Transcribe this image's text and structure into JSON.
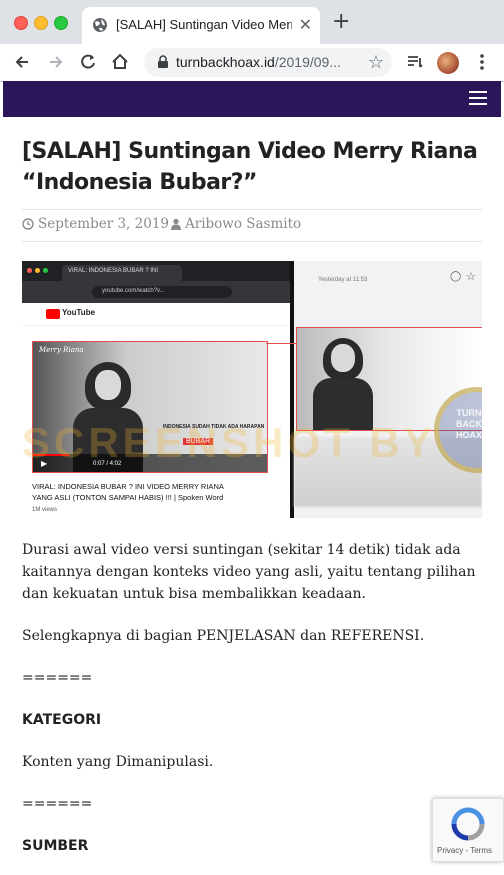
{
  "browser": {
    "tab_title": "[SALAH] Suntingan Video Merry Riana",
    "url_host": "turnbackhoax.id",
    "url_path": "/2019/09..."
  },
  "article": {
    "title": "[SALAH] Suntingan Video Merry Riana “Indonesia Bubar?”",
    "date": "September 3, 2019",
    "author": "Aribowo Sasmito",
    "paragraph1": "Durasi awal video versi suntingan (sekitar 14 detik) tidak ada kaitannya dengan konteks video yang asli, yaitu tentang pilihan dan kekuatan untuk bisa membalikkan keadaan.",
    "paragraph2": "Selengkapnya di bagian PENJELASAN dan REFERENSI.",
    "separator1": "======",
    "kategori_heading": "KATEGORI",
    "kategori_value": "Konten yang Dimanipulasi.",
    "separator2": "======",
    "sumber_heading": "SUMBER"
  },
  "featured_image": {
    "video_tab": "VIRAL: INDONESIA BUBAR ? INI",
    "video_url": "youtube.com/watch?v...",
    "youtube_logo": "YouTube",
    "watermark": "Merry Riana",
    "overlay_caption": "INDONESIA SUDAH TIDAK ADA HARAPAN",
    "overlay_caption2": "BUBAR",
    "time": "0:07 / 4:02",
    "video_title_line1": "VIRAL: INDONESIA BUBAR ? INI VIDEO MERRY RIANA",
    "video_title_line2": "YANG ASLI (TONTON SAMPAI HABIS) !!! | Spoken Word",
    "video_meta": "1M views",
    "fb_time": "Yesterday at 11:53",
    "screenshot_text": "SCREENSHOT BY",
    "stamp_text1": "TURN",
    "stamp_text2": "BACK",
    "stamp_text3": "HOAX"
  },
  "recaptcha": {
    "privacy": "Privacy",
    "terms": "Terms"
  }
}
